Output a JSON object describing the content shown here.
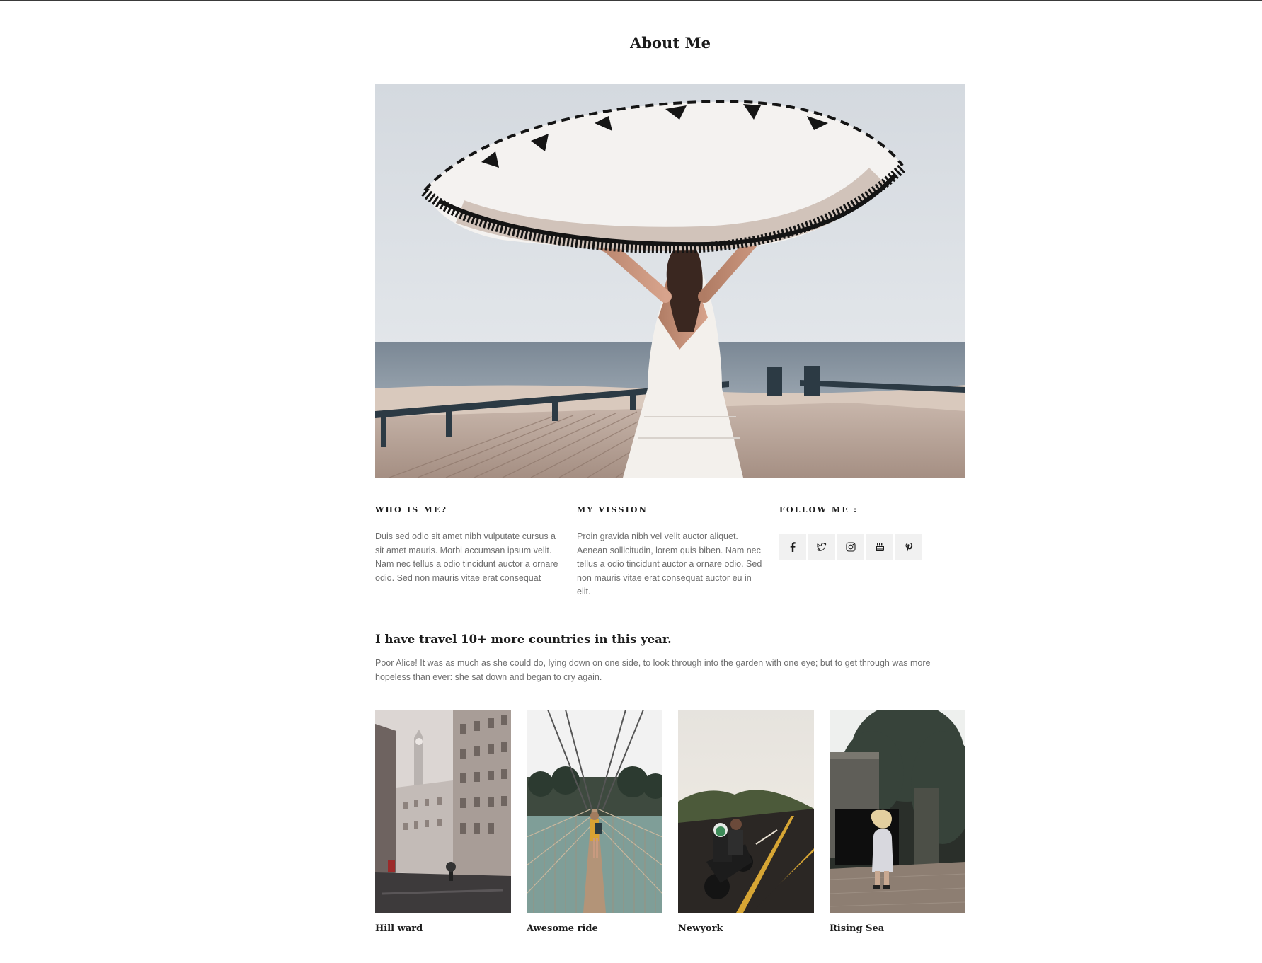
{
  "page": {
    "title": "About Me"
  },
  "hero": {
    "image_name": "woman-holding-tassel-blanket-by-sea"
  },
  "who": {
    "heading": "WHO IS ME?",
    "text": "Duis sed odio sit amet nibh vulputate cursus a sit amet mauris. Morbi accumsan ipsum velit. Nam nec tellus a odio tincidunt auctor a ornare odio. Sed non mauris vitae erat consequat"
  },
  "vission": {
    "heading": "MY VISSION",
    "text": "Proin gravida nibh vel velit auctor aliquet. Aenean sollicitudin, lorem quis biben. Nam nec tellus a odio tincidunt auctor a ornare odio. Sed non mauris vitae erat consequat auctor eu in elit."
  },
  "follow": {
    "heading": "FOLLOW ME :",
    "icons": [
      "facebook-icon",
      "twitter-icon",
      "instagram-icon",
      "youtube-icon",
      "pinterest-icon"
    ]
  },
  "travel": {
    "heading": "I have travel 10+ more countries in this year.",
    "text": "Poor Alice! It was as much as she could do, lying down on one side, to look through into the garden with one eye; but to get through was more hopeless than ever: she sat down and began to cry again."
  },
  "gallery": [
    {
      "caption": "Hill ward"
    },
    {
      "caption": "Awesome ride"
    },
    {
      "caption": "Newyork"
    },
    {
      "caption": "Rising Sea"
    }
  ],
  "colors": {
    "heading": "#1c1c1c",
    "body_text": "#6e6e6e",
    "social_bg": "#f1f1f1"
  }
}
